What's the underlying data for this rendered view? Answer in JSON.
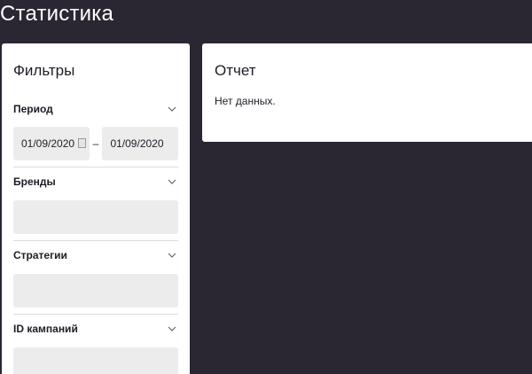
{
  "page": {
    "title": "Статистика"
  },
  "filters": {
    "title": "Фильтры",
    "period": {
      "label": "Период",
      "date_from": "01/09/2020",
      "separator": "–",
      "date_to": "01/09/2020"
    },
    "brands": {
      "label": "Бренды",
      "value": ""
    },
    "strategies": {
      "label": "Стратегии",
      "value": ""
    },
    "campaign_ids": {
      "label": "ID кампаний",
      "value": ""
    }
  },
  "report": {
    "title": "Отчет",
    "empty_message": "Нет данных."
  },
  "colors": {
    "background": "#2a2733",
    "panel": "#ffffff",
    "field": "#ececec",
    "text": "#1f1c26"
  },
  "icons": [
    "chevron-down-icon",
    "calendar-icon"
  ]
}
